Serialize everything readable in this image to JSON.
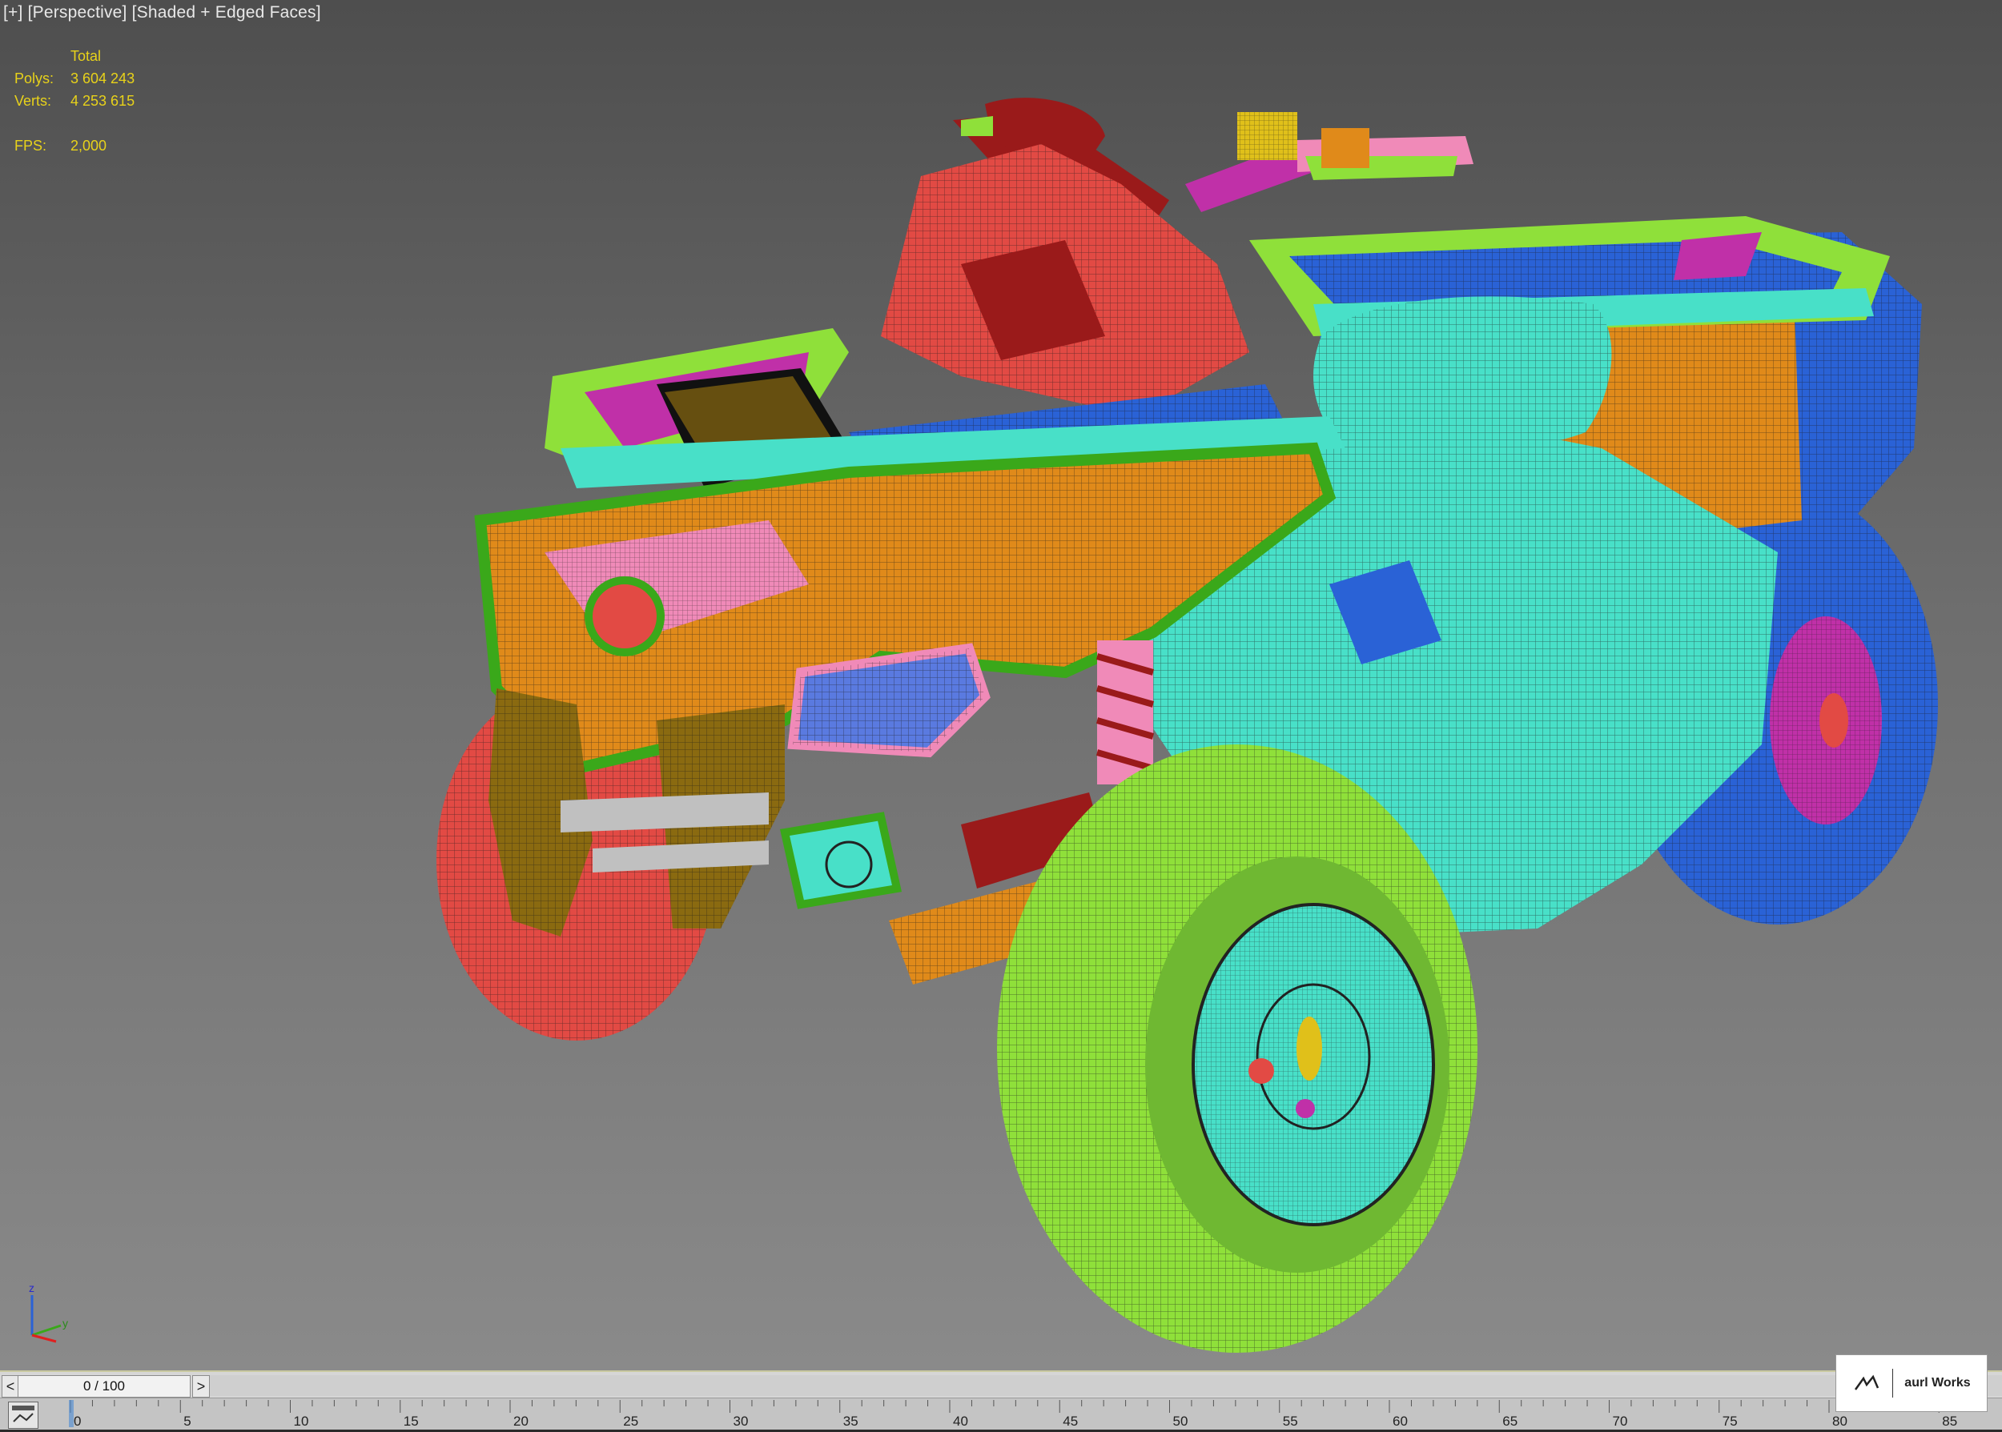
{
  "viewport": {
    "label_parts": [
      "[+]",
      "[Perspective]",
      "[Shaded + Edged Faces]"
    ],
    "stats": {
      "header": "Total",
      "polys_label": "Polys:",
      "polys_value": "3 604 243",
      "verts_label": "Verts:",
      "verts_value": "4 253 615",
      "fps_label": "FPS:",
      "fps_value": "2,000"
    },
    "axis": {
      "z": "z",
      "y": "y",
      "x": "x"
    },
    "colors": {
      "green": "#8fe03a",
      "cyan": "#48e0c8",
      "blue": "#2a62d6",
      "orange": "#e08a1a",
      "red": "#e24a44",
      "pink": "#f08ab8",
      "magenta": "#c030a8",
      "olive": "#8a6a10",
      "darkred": "#9a1a1a"
    }
  },
  "timeline": {
    "frame_display": "0 / 100",
    "prev_label": "<",
    "next_label": ">",
    "ruler_ticks": [
      "0",
      "5",
      "10",
      "15",
      "20",
      "25",
      "30",
      "35",
      "40",
      "45",
      "50",
      "55",
      "60",
      "65",
      "70",
      "75",
      "80",
      "85"
    ]
  },
  "watermark": {
    "text": "aurl Works"
  }
}
